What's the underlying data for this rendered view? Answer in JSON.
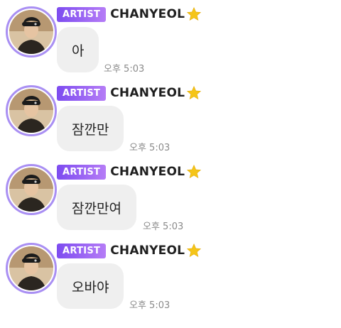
{
  "chat": {
    "badge_label": "ARTIST",
    "artist_name": "CHANYEOL",
    "star_icon": "star-icon",
    "avatar_icon": "profile-avatar",
    "colors": {
      "badge_start": "#7d4cf0",
      "badge_end": "#b57cf6",
      "avatar_ring": "#a98ff3",
      "bubble": "#efefef",
      "star": "#f5c518"
    },
    "messages": [
      {
        "text": "아",
        "time": "오후 5:03"
      },
      {
        "text": "잠깐만",
        "time": "오후 5:03"
      },
      {
        "text": "잠깐만여",
        "time": "오후 5:03"
      },
      {
        "text": "오바야",
        "time": "오후 5:03"
      }
    ]
  }
}
